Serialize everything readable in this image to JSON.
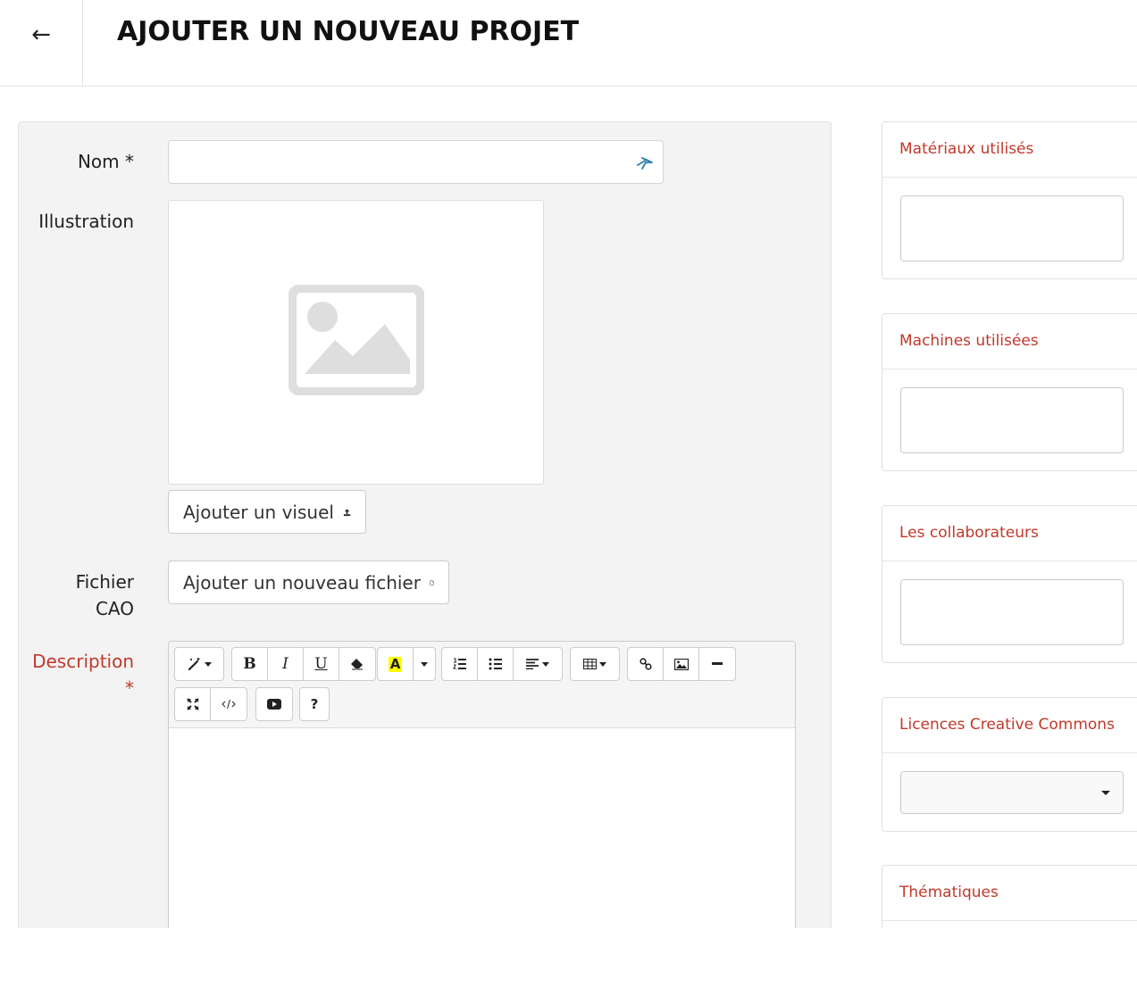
{
  "header": {
    "back_icon": "arrow-left-icon",
    "back_glyph": "←",
    "title": "AJOUTER UN NOUVEAU PROJET"
  },
  "form": {
    "nom_label": "Nom *",
    "illustration_label": "Illustration",
    "add_visual_label": "Ajouter un visuel",
    "cao_label_line1": "Fichier",
    "cao_label_line2": "CAO",
    "add_file_label": "Ajouter un nouveau fichier",
    "description_label": "Description",
    "description_required": "*"
  },
  "editor": {
    "toolbar_row1": [
      "style",
      "bold",
      "italic",
      "underline",
      "eraser",
      "highlight",
      "highlight-dropdown",
      "ordered-list",
      "unordered-list",
      "paragraph-align",
      "table",
      "link",
      "picture",
      "horizontal-rule"
    ],
    "toolbar_row2": [
      "fullscreen",
      "code-view",
      "video",
      "help"
    ],
    "bold": "B",
    "italic": "I",
    "underline": "U",
    "highlight": "A",
    "help": "?"
  },
  "sidebar": {
    "materials_title": "Matériaux utilisés",
    "machines_title": "Machines utilisées",
    "collaborators_title": "Les collaborateurs",
    "licences_title": "Licences Creative Commons",
    "themes_title": "Thématiques"
  },
  "colors": {
    "accent_red": "#c0392b",
    "panel_bg": "#f3f3f3",
    "highlight_yellow": "#ffff00"
  }
}
